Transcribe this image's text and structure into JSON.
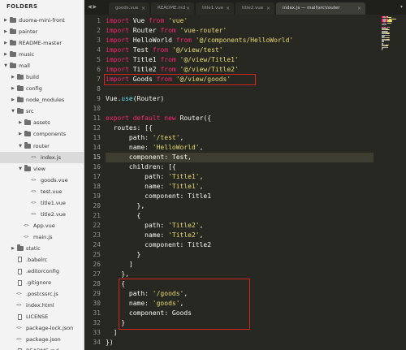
{
  "sidebar": {
    "title": "FOLDERS",
    "items": [
      {
        "label": "duoma-mini-front",
        "type": "folder",
        "depth": 0,
        "expanded": false,
        "name": "folder-duoma-mini-front"
      },
      {
        "label": "painter",
        "type": "folder",
        "depth": 0,
        "expanded": false,
        "name": "folder-painter"
      },
      {
        "label": "README-master",
        "type": "folder",
        "depth": 0,
        "expanded": false,
        "name": "folder-readme-master"
      },
      {
        "label": "music",
        "type": "folder",
        "depth": 0,
        "expanded": false,
        "name": "folder-music"
      },
      {
        "label": "mall",
        "type": "folder",
        "depth": 0,
        "expanded": true,
        "name": "folder-mall"
      },
      {
        "label": "build",
        "type": "folder",
        "depth": 1,
        "expanded": false,
        "name": "folder-build"
      },
      {
        "label": "config",
        "type": "folder",
        "depth": 1,
        "expanded": false,
        "name": "folder-config"
      },
      {
        "label": "node_modules",
        "type": "folder",
        "depth": 1,
        "expanded": false,
        "name": "folder-node-modules"
      },
      {
        "label": "src",
        "type": "folder",
        "depth": 1,
        "expanded": true,
        "name": "folder-src"
      },
      {
        "label": "assets",
        "type": "folder",
        "depth": 2,
        "expanded": false,
        "name": "folder-assets"
      },
      {
        "label": "components",
        "type": "folder",
        "depth": 2,
        "expanded": false,
        "name": "folder-components"
      },
      {
        "label": "router",
        "type": "folder",
        "depth": 2,
        "expanded": true,
        "name": "folder-router"
      },
      {
        "label": "index.js",
        "type": "code",
        "depth": 3,
        "selected": true,
        "name": "file-router-index-js"
      },
      {
        "label": "view",
        "type": "folder",
        "depth": 2,
        "expanded": true,
        "name": "folder-view"
      },
      {
        "label": "goods.vue",
        "type": "code",
        "depth": 3,
        "name": "file-goods-vue"
      },
      {
        "label": "test.vue",
        "type": "code",
        "depth": 3,
        "name": "file-test-vue"
      },
      {
        "label": "title1.vue",
        "type": "code",
        "depth": 3,
        "name": "file-title1-vue"
      },
      {
        "label": "title2.vue",
        "type": "code",
        "depth": 3,
        "name": "file-title2-vue"
      },
      {
        "label": "App.vue",
        "type": "code",
        "depth": 2,
        "name": "file-app-vue"
      },
      {
        "label": "main.js",
        "type": "code",
        "depth": 2,
        "name": "file-main-js"
      },
      {
        "label": "static",
        "type": "folder",
        "depth": 1,
        "expanded": false,
        "name": "folder-static"
      },
      {
        "label": ".babelrc",
        "type": "doc",
        "depth": 1,
        "name": "file-babelrc"
      },
      {
        "label": ".editorconfig",
        "type": "doc",
        "depth": 1,
        "name": "file-editorconfig"
      },
      {
        "label": ".gitignore",
        "type": "doc",
        "depth": 1,
        "name": "file-gitignore"
      },
      {
        "label": ".postcssrc.js",
        "type": "code",
        "depth": 1,
        "name": "file-postcssrc-js"
      },
      {
        "label": "index.html",
        "type": "code",
        "depth": 1,
        "name": "file-index-html"
      },
      {
        "label": "LICENSE",
        "type": "doc",
        "depth": 1,
        "name": "file-license"
      },
      {
        "label": "package-lock.json",
        "type": "code",
        "depth": 1,
        "name": "file-package-lock-json"
      },
      {
        "label": "package.json",
        "type": "code",
        "depth": 1,
        "name": "file-package-json"
      },
      {
        "label": "README.md",
        "type": "doc",
        "depth": 1,
        "name": "file-readme-md"
      }
    ]
  },
  "tabbar": {
    "nav": "◀ ▶",
    "dropdown": "▾",
    "close_glyph": "×",
    "tabs": [
      {
        "label": "goods.vue",
        "active": false,
        "name": "tab-goods-vue"
      },
      {
        "label": "README.md",
        "active": false,
        "name": "tab-readme-md"
      },
      {
        "label": "title1.vue",
        "active": false,
        "name": "tab-title1-vue"
      },
      {
        "label": "title2.vue",
        "active": false,
        "name": "tab-title2-vue"
      },
      {
        "label": "index.js — mall\\src\\router",
        "active": true,
        "name": "tab-index-js"
      }
    ]
  },
  "editor": {
    "current_line": 15,
    "lines": [
      [
        [
          "kw",
          "import"
        ],
        [
          "tx",
          " Vue "
        ],
        [
          "kw",
          "from"
        ],
        [
          "tx",
          " "
        ],
        [
          "st",
          "'vue'"
        ]
      ],
      [
        [
          "kw",
          "import"
        ],
        [
          "tx",
          " Router "
        ],
        [
          "kw",
          "from"
        ],
        [
          "tx",
          " "
        ],
        [
          "st",
          "'vue-router'"
        ]
      ],
      [
        [
          "kw",
          "import"
        ],
        [
          "tx",
          " HelloWorld "
        ],
        [
          "kw",
          "from"
        ],
        [
          "tx",
          " "
        ],
        [
          "st",
          "'@/components/HelloWorld'"
        ]
      ],
      [
        [
          "kw",
          "import"
        ],
        [
          "tx",
          " Test "
        ],
        [
          "kw",
          "from"
        ],
        [
          "tx",
          " "
        ],
        [
          "st",
          "'@/view/test'"
        ]
      ],
      [
        [
          "kw",
          "import"
        ],
        [
          "tx",
          " Title1 "
        ],
        [
          "kw",
          "from"
        ],
        [
          "tx",
          " "
        ],
        [
          "st",
          "'@/view/Title1'"
        ]
      ],
      [
        [
          "kw",
          "import"
        ],
        [
          "tx",
          " Title2 "
        ],
        [
          "kw",
          "from"
        ],
        [
          "tx",
          " "
        ],
        [
          "st",
          "'@/view/Title2'"
        ]
      ],
      [
        [
          "kw",
          "import"
        ],
        [
          "tx",
          " Goods "
        ],
        [
          "kw",
          "from"
        ],
        [
          "tx",
          " "
        ],
        [
          "st",
          "'@/view/goods'"
        ]
      ],
      [],
      [
        [
          "tx",
          "Vue."
        ],
        [
          "fn",
          "use"
        ],
        [
          "tx",
          "(Router)"
        ]
      ],
      [],
      [
        [
          "kw",
          "export"
        ],
        [
          "tx",
          " "
        ],
        [
          "kw",
          "default"
        ],
        [
          "tx",
          " "
        ],
        [
          "kw",
          "new"
        ],
        [
          "tx",
          " Router({"
        ]
      ],
      [
        [
          "tx",
          "  routes: [{"
        ]
      ],
      [
        [
          "tx",
          "      path: "
        ],
        [
          "st",
          "'/test'"
        ],
        [
          "tx",
          ","
        ]
      ],
      [
        [
          "tx",
          "      name: "
        ],
        [
          "st",
          "'HelloWorld'"
        ],
        [
          "tx",
          ","
        ]
      ],
      [
        [
          "tx",
          "      component: Test,"
        ]
      ],
      [
        [
          "tx",
          "      children: [{"
        ]
      ],
      [
        [
          "tx",
          "          path: "
        ],
        [
          "st",
          "'Title1'"
        ],
        [
          "tx",
          ","
        ]
      ],
      [
        [
          "tx",
          "          name: "
        ],
        [
          "st",
          "'Title1'"
        ],
        [
          "tx",
          ","
        ]
      ],
      [
        [
          "tx",
          "          component: Title1"
        ]
      ],
      [
        [
          "tx",
          "        },"
        ]
      ],
      [
        [
          "tx",
          "        {"
        ]
      ],
      [
        [
          "tx",
          "          path: "
        ],
        [
          "st",
          "'Title2'"
        ],
        [
          "tx",
          ","
        ]
      ],
      [
        [
          "tx",
          "          name: "
        ],
        [
          "st",
          "'Title2'"
        ],
        [
          "tx",
          ","
        ]
      ],
      [
        [
          "tx",
          "          component: Title2"
        ]
      ],
      [
        [
          "tx",
          "        }"
        ]
      ],
      [
        [
          "tx",
          "      ]"
        ]
      ],
      [
        [
          "tx",
          "    },"
        ]
      ],
      [
        [
          "tx",
          "    {"
        ]
      ],
      [
        [
          "tx",
          "      path: "
        ],
        [
          "st",
          "'/goods'"
        ],
        [
          "tx",
          ","
        ]
      ],
      [
        [
          "tx",
          "      name: "
        ],
        [
          "st",
          "'goods'"
        ],
        [
          "tx",
          ","
        ]
      ],
      [
        [
          "tx",
          "      component: Goods"
        ]
      ],
      [
        [
          "tx",
          "    }"
        ]
      ],
      [
        [
          "tx",
          "  ]"
        ]
      ],
      [
        [
          "tx",
          "})"
        ]
      ]
    ]
  },
  "colors": {
    "keyword": "#f92672",
    "string": "#e6db74",
    "function": "#66d9ef",
    "text": "#f8f8f2",
    "highlight_box": "#d5261c",
    "background": "#272822"
  }
}
